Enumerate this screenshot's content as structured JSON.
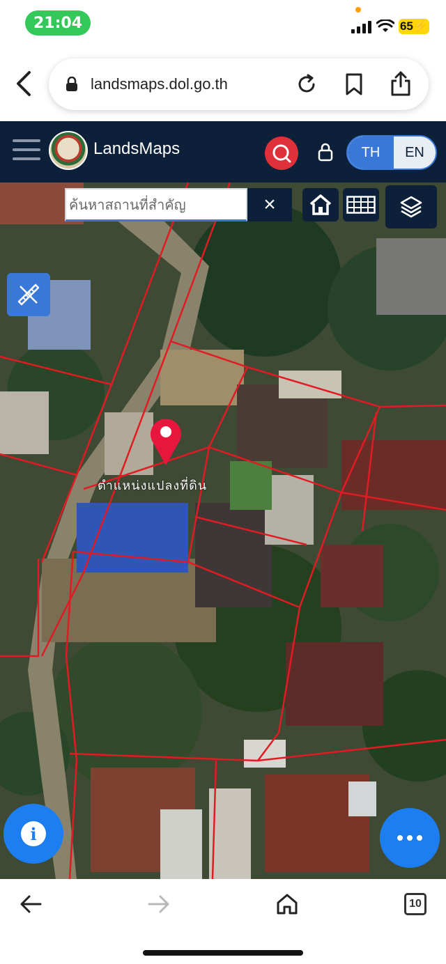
{
  "status_bar": {
    "time": "21:04",
    "battery": "65"
  },
  "browser": {
    "url": "landsmaps.dol.go.th"
  },
  "app": {
    "brand": "LandsMaps",
    "lang": {
      "th": "TH",
      "en": "EN"
    }
  },
  "map": {
    "search": {
      "placeholder": "ค้นหาสถานที่สำคัญ",
      "value": ""
    },
    "clear_label": "×",
    "parcel_label": "ตำแหน่งแปลงที่ดิน",
    "info_label": "i"
  },
  "bottom_bar": {
    "tabs_count": "10"
  },
  "colors": {
    "header_bg": "#0d2039",
    "accent_blue": "#3a78d8",
    "search_red": "#e0303a",
    "fab_blue": "#1c7ef0",
    "parcel_line": "#e01b24",
    "pin_red": "#e8163c",
    "time_green": "#34c759"
  },
  "icons": [
    "back-icon",
    "lock-icon",
    "reload-icon",
    "bookmark-icon",
    "share-icon",
    "menu-icon",
    "search-icon",
    "home-icon",
    "grid-icon",
    "layers-icon",
    "ruler-icon",
    "pin-icon",
    "info-icon",
    "more-icon",
    "forward-icon",
    "tabs-icon"
  ]
}
